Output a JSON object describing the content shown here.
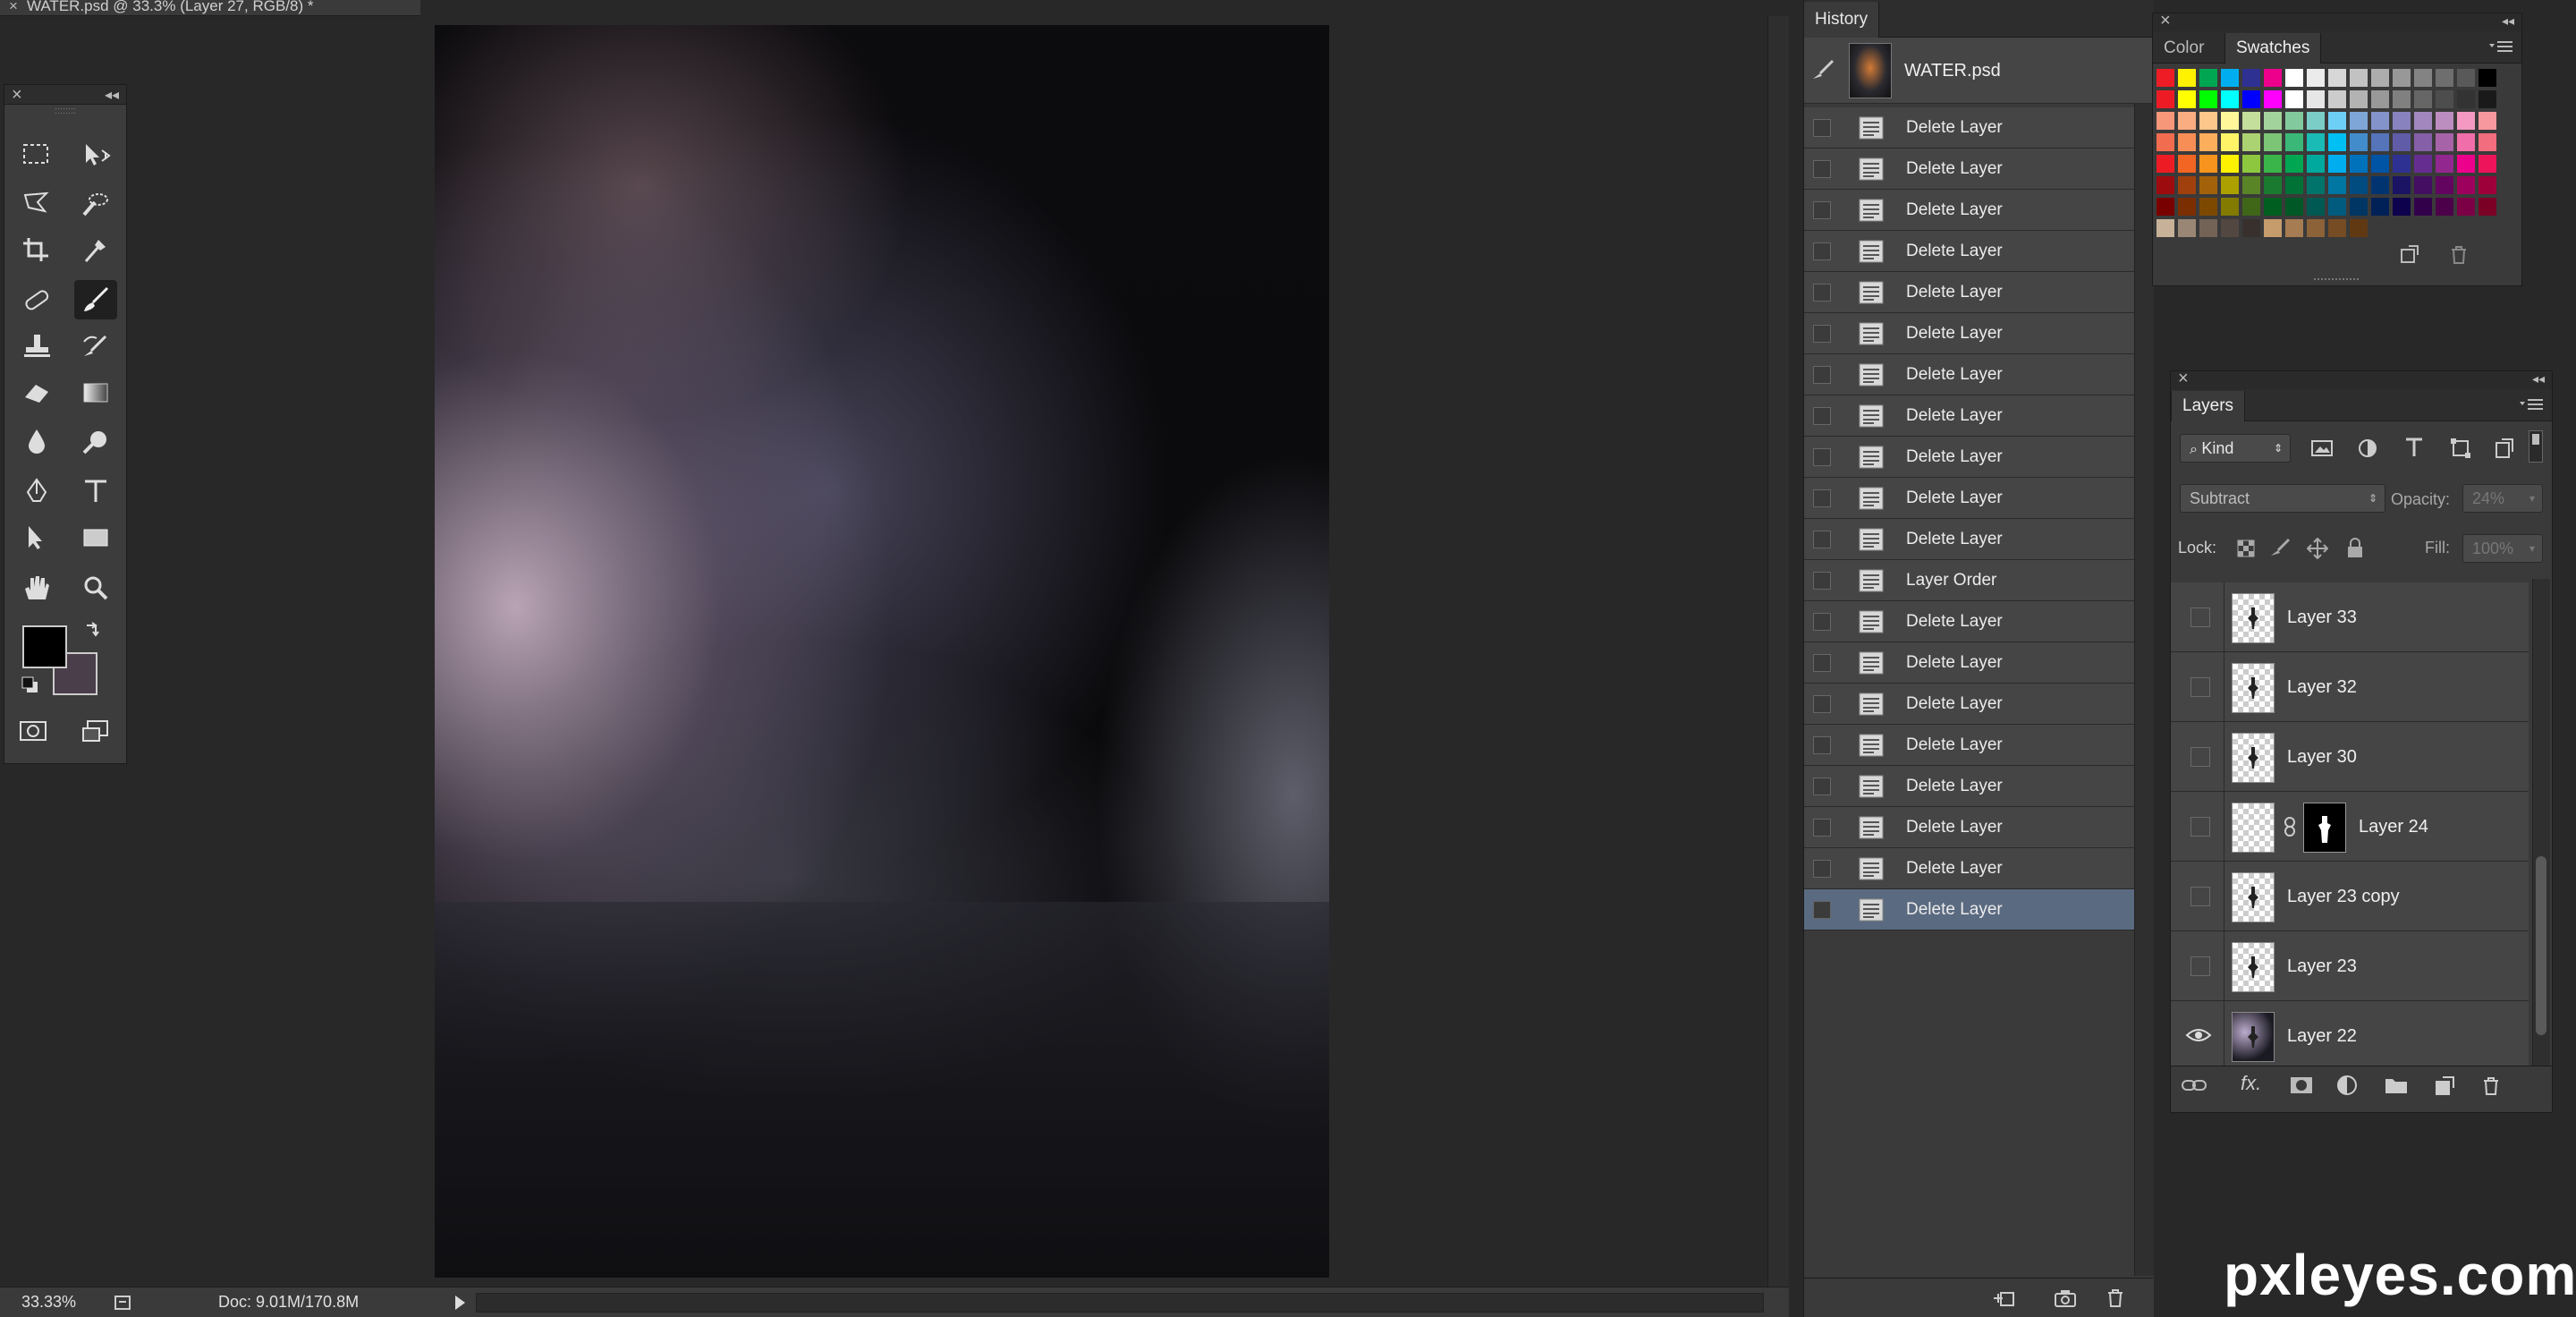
{
  "document_tab": {
    "close": "×",
    "title": "WATER.psd @ 33.3% (Layer 27, RGB/8) *"
  },
  "tools_panel": {
    "close": "×",
    "collapse": "◂◂",
    "grip": "::::::::"
  },
  "status_bar": {
    "zoom": "33.33%",
    "doc_info": "Doc: 9.01M/170.8M"
  },
  "history": {
    "title": "History",
    "snapshot": "WATER.psd",
    "items": [
      "Delete Layer",
      "Delete Layer",
      "Delete Layer",
      "Delete Layer",
      "Delete Layer",
      "Delete Layer",
      "Delete Layer",
      "Delete Layer",
      "Delete Layer",
      "Delete Layer",
      "Delete Layer",
      "Layer Order",
      "Delete Layer",
      "Delete Layer",
      "Delete Layer",
      "Delete Layer",
      "Delete Layer",
      "Delete Layer",
      "Delete Layer",
      "Delete Layer"
    ],
    "selected_index": 19
  },
  "swatches_panel": {
    "tabs": [
      "Color",
      "Swatches"
    ],
    "active_tab": "Swatches",
    "rows": [
      [
        "#ee1c24",
        "#fff200",
        "#00a651",
        "#00aeef",
        "#2e3192",
        "#ec008c",
        "#ffffff",
        "#ebebeb",
        "#d7d7d7",
        "#c2c2c2",
        "#adadad",
        "#989898",
        "#838383",
        "#6e6e6e",
        "#595959",
        "#000000"
      ],
      [
        "#ed1c24",
        "#ffff00",
        "#00ff00",
        "#00ffff",
        "#0000ff",
        "#ff00ff",
        "#ffffff",
        "#e6e6e6",
        "#cccccc",
        "#b3b3b3",
        "#999999",
        "#808080",
        "#666666",
        "#4d4d4d",
        "#333333",
        "#1a1a1a"
      ],
      [
        "#f7977a",
        "#f9ad81",
        "#fdc68a",
        "#fff79a",
        "#c4df9b",
        "#a3d39c",
        "#82ca9d",
        "#7bcdc8",
        "#6ecff6",
        "#7ea7d8",
        "#8493ca",
        "#8882be",
        "#a187be",
        "#bc8dbf",
        "#f49ac2",
        "#f6989d"
      ],
      [
        "#f26c4f",
        "#f68e55",
        "#fbaf5c",
        "#fff467",
        "#acd372",
        "#7cc576",
        "#3bb878",
        "#1abbb4",
        "#00bff3",
        "#438ccb",
        "#5574b9",
        "#605ca8",
        "#855fa8",
        "#a763a8",
        "#f06ea9",
        "#f26d7d"
      ],
      [
        "#ed1c24",
        "#f26522",
        "#f7941d",
        "#fff200",
        "#8dc73f",
        "#39b54a",
        "#00a651",
        "#00a99d",
        "#00aeef",
        "#0072bc",
        "#0054a5",
        "#2e3192",
        "#662d91",
        "#92278f",
        "#ec008c",
        "#ed145b"
      ],
      [
        "#9e0b0f",
        "#a0410d",
        "#a36209",
        "#aba000",
        "#598527",
        "#1a7b30",
        "#007236",
        "#00746b",
        "#0076a3",
        "#004b80",
        "#003471",
        "#1b1464",
        "#440e62",
        "#630460",
        "#9e005d",
        "#9e0039"
      ],
      [
        "#790000",
        "#7b2e00",
        "#7d4900",
        "#827b00",
        "#406618",
        "#005e20",
        "#005826",
        "#005952",
        "#005b7f",
        "#003663",
        "#002157",
        "#0d004c",
        "#32004b",
        "#4b0049",
        "#7b0046",
        "#7a0026"
      ],
      [
        "#c7b299",
        "#998675",
        "#736357",
        "#534741",
        "#37302d",
        "#c69c6d",
        "#a67c52",
        "#8c6239",
        "#754c24",
        "#603913"
      ]
    ]
  },
  "layers": {
    "title": "Layers",
    "filter": "Kind",
    "blend_mode": "Subtract",
    "opacity_label": "Opacity:",
    "opacity": "24%",
    "lock_label": "Lock:",
    "fill_label": "Fill:",
    "fill": "100%",
    "items": [
      {
        "name": "Layer 33",
        "visible": false
      },
      {
        "name": "Layer 32",
        "visible": false
      },
      {
        "name": "Layer 30",
        "visible": false
      },
      {
        "name": "Layer 24",
        "visible": false,
        "mask": true
      },
      {
        "name": "Layer 23 copy",
        "visible": false
      },
      {
        "name": "Layer 23",
        "visible": false
      },
      {
        "name": "Layer 22",
        "visible": true
      }
    ]
  },
  "watermark": "pxleyes.com"
}
